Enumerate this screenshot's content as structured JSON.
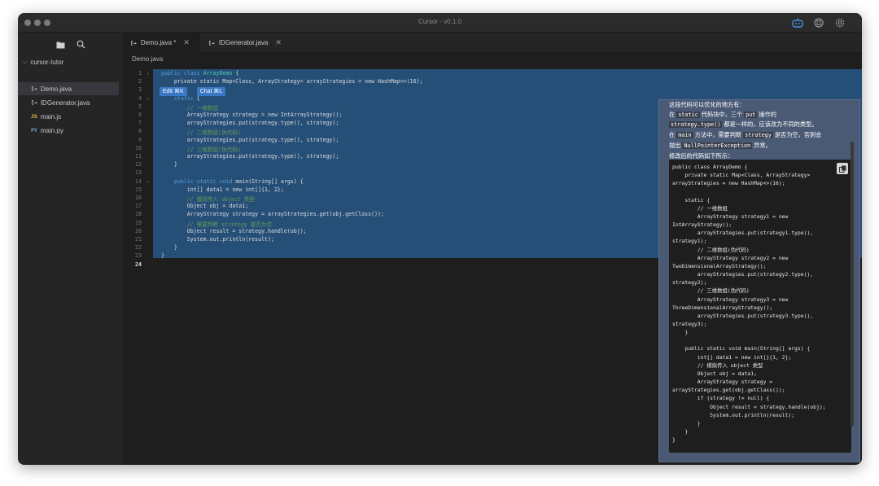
{
  "window": {
    "title": "Cursor - v0.1.0"
  },
  "sidebar": {
    "root": "cursor-tutor",
    "items": [
      {
        "tag": "[→",
        "label": "Demo.java",
        "color": "#cfcfcf"
      },
      {
        "tag": "[→",
        "label": "IDGenerator.java",
        "color": "#cfcfcf"
      },
      {
        "tag": "JS",
        "label": "main.js",
        "color": "#e8c547"
      },
      {
        "tag": "PY",
        "label": "main.py",
        "color": "#6fa8dc"
      }
    ]
  },
  "tabs": [
    {
      "label": "Demo.java *"
    },
    {
      "label": "IDGenerator.java"
    }
  ],
  "breadcrumb": "Demo.java",
  "edit_chat": {
    "edit": "Edit ⌘K",
    "chat": "Chat ⌘L"
  },
  "code": {
    "line_numbers": [
      "1",
      "2",
      "3",
      "4",
      "5",
      "6",
      "7",
      "8",
      "9",
      "10",
      "11",
      "12",
      "13",
      "14",
      "15",
      "16",
      "17",
      "18",
      "19",
      "20",
      "21",
      "22",
      "23",
      "24"
    ],
    "lines": [
      {
        "k": "public class ",
        "t": "ArrayDemo",
        "r": " {"
      },
      {
        "r": "    private static Map<Class, ArrayStrategy> arrayStrategies = new HashMap<>(16);"
      },
      {
        "r": ""
      },
      {
        "k": "    static",
        "r": " {"
      },
      {
        "c": "        // 一维数组"
      },
      {
        "r": "        ArrayStrategy strategy = new IntArrayStrategy();"
      },
      {
        "r": "        arrayStrategies.put(strategy.type(), strategy);"
      },
      {
        "c": "        // 二维数组(伪代码)"
      },
      {
        "r": "        arrayStrategies.put(strategy.type(), strategy);"
      },
      {
        "c": "        // 三维数组(伪代码)"
      },
      {
        "r": "        arrayStrategies.put(strategy.type(), strategy);"
      },
      {
        "r": "    }"
      },
      {
        "r": ""
      },
      {
        "k": "    public static void",
        "r": " main(String[] args) {"
      },
      {
        "r": "        int[] data1 = new int[]{1, 2};"
      },
      {
        "c": "        // 模拟传入 object 类型"
      },
      {
        "r": "        Object obj = data1;"
      },
      {
        "r": "        ArrayStrategy strategy = arrayStrategies.get(obj.getClass());"
      },
      {
        "c": "        // 需要判断 strategy 是否为空"
      },
      {
        "r": "        Object result = strategy.handle(obj);"
      },
      {
        "r": "        System.out.println(result);"
      },
      {
        "r": "    }"
      },
      {
        "r": "}"
      },
      {
        "r": ""
      }
    ]
  },
  "chat": {
    "intro": "这段代码可以优化的地方有：",
    "p1_a": "在",
    "p1_code1": "static",
    "p1_b": "代码块中，三个",
    "p1_code2": "put",
    "p1_c": "操作的",
    "p2_code": "strategy.type()",
    "p2_b": "都是一样的，应该改为不同的类型。",
    "p3_a": "在",
    "p3_code1": "main",
    "p3_b": "方法中，需要判断",
    "p3_code2": "strategy",
    "p3_c": "是否为空，否则会",
    "p4_a": "抛出",
    "p4_code": "NullPointerException",
    "p4_b": "异常。",
    "p5": "修改后的代码如下所示：",
    "code_block": "public class ArrayDemo {\n    private static Map<Class, ArrayStrategy> arrayStrategies = new HashMap<>(16);\n\n    static {\n        // 一维数组\n        ArrayStrategy strategy1 = new IntArrayStrategy();\n        arrayStrategies.put(strategy1.type(), strategy1);\n        // 二维数组(伪代码)\n        ArrayStrategy strategy2 = new TwoDimensionalArrayStrategy();\n        arrayStrategies.put(strategy2.type(), strategy2);\n        // 三维数组(伪代码)\n        ArrayStrategy strategy3 = new ThreeDimensionalArrayStrategy();\n        arrayStrategies.put(strategy3.type(), strategy3);\n    }\n\n    public static void main(String[] args) {\n        int[] data1 = new int[]{1, 2};\n        // 模拟传入 object 类型\n        Object obj = data1;\n        ArrayStrategy strategy = arrayStrategies.get(obj.getClass());\n        if (strategy != null) {\n            Object result = strategy.handle(obj);\n            System.out.println(result);\n        }\n    }\n}"
  },
  "colors": {
    "accent": "#3b78c4",
    "selection": "#264f78",
    "panel": "#4a5a75"
  }
}
